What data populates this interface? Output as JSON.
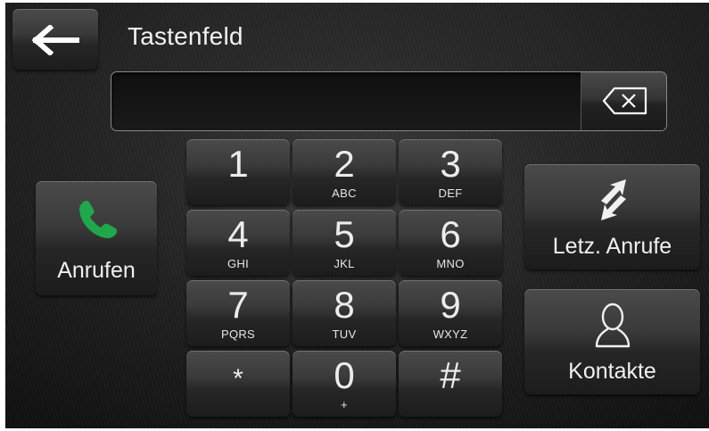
{
  "header": {
    "title": "Tastenfeld",
    "back_icon": "arrow-left-icon"
  },
  "number_field": {
    "value": "",
    "backspace_icon": "backspace-icon"
  },
  "keypad": {
    "keys": [
      {
        "digit": "1",
        "letters": ""
      },
      {
        "digit": "2",
        "letters": "ABC"
      },
      {
        "digit": "3",
        "letters": "DEF"
      },
      {
        "digit": "4",
        "letters": "GHI"
      },
      {
        "digit": "5",
        "letters": "JKL"
      },
      {
        "digit": "6",
        "letters": "MNO"
      },
      {
        "digit": "7",
        "letters": "PQRS"
      },
      {
        "digit": "8",
        "letters": "TUV"
      },
      {
        "digit": "9",
        "letters": "WXYZ"
      },
      {
        "digit": "*",
        "letters": ""
      },
      {
        "digit": "0",
        "letters": "+"
      },
      {
        "digit": "#",
        "letters": ""
      }
    ]
  },
  "actions": {
    "call": {
      "label": "Anrufen",
      "icon": "phone-icon",
      "icon_color": "#1fa84a"
    },
    "recent_calls": {
      "label": "Letz. Anrufe",
      "icon": "recent-calls-icon"
    },
    "contacts": {
      "label": "Kontakte",
      "icon": "contact-person-icon"
    }
  },
  "theme": {
    "background": "#1b1b1b",
    "text": "#f0f0f0",
    "accent_green": "#1fa84a"
  }
}
